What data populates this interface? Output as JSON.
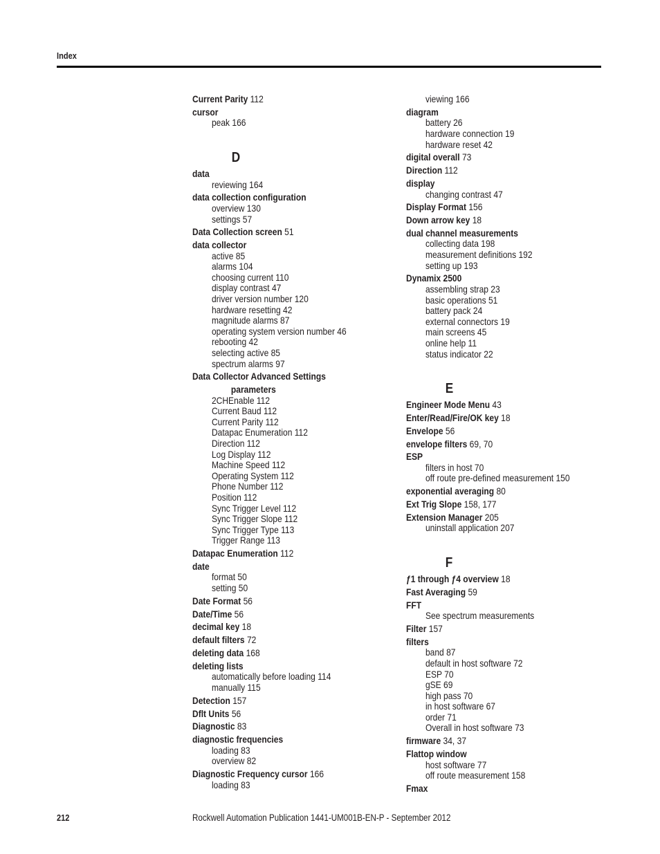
{
  "header": {
    "title": "Index"
  },
  "footer": {
    "page_number": "212",
    "publication": "Rockwell Automation Publication 1441-UM001B-EN-P - September 2012"
  },
  "columns": [
    [
      {
        "type": "main",
        "term": "Current Parity",
        "pages": "112"
      },
      {
        "type": "main",
        "term": "cursor",
        "pages": ""
      },
      {
        "type": "sub",
        "text": "peak 166"
      },
      {
        "type": "letter",
        "text": "D"
      },
      {
        "type": "main",
        "term": "data",
        "pages": ""
      },
      {
        "type": "sub",
        "text": "reviewing 164"
      },
      {
        "type": "main",
        "term": "data collection configuration",
        "pages": ""
      },
      {
        "type": "sub",
        "text": "overview 130"
      },
      {
        "type": "sub",
        "text": "settings 57"
      },
      {
        "type": "main",
        "term": "Data Collection screen",
        "pages": "51"
      },
      {
        "type": "main",
        "term": "data collector",
        "pages": ""
      },
      {
        "type": "sub",
        "text": "active 85"
      },
      {
        "type": "sub",
        "text": "alarms 104"
      },
      {
        "type": "sub",
        "text": "choosing current 110"
      },
      {
        "type": "sub",
        "text": "display contrast 47"
      },
      {
        "type": "sub",
        "text": "driver version number 120"
      },
      {
        "type": "sub",
        "text": "hardware resetting 42"
      },
      {
        "type": "sub",
        "text": "magnitude alarms 87"
      },
      {
        "type": "sub",
        "text": "operating system version number 46"
      },
      {
        "type": "sub",
        "text": "rebooting 42"
      },
      {
        "type": "sub",
        "text": "selecting active 85"
      },
      {
        "type": "sub",
        "text": "spectrum alarms 97"
      },
      {
        "type": "main",
        "term": "Data Collector Advanced Settings",
        "pages": ""
      },
      {
        "type": "subhead",
        "text": "parameters"
      },
      {
        "type": "sub",
        "text": "2CHEnable 112"
      },
      {
        "type": "sub",
        "text": "Current Baud 112"
      },
      {
        "type": "sub",
        "text": "Current Parity 112"
      },
      {
        "type": "sub",
        "text": "Datapac Enumeration 112"
      },
      {
        "type": "sub",
        "text": "Direction 112"
      },
      {
        "type": "sub",
        "text": "Log Display 112"
      },
      {
        "type": "sub",
        "text": "Machine Speed 112"
      },
      {
        "type": "sub",
        "text": "Operating System 112"
      },
      {
        "type": "sub",
        "text": "Phone Number 112"
      },
      {
        "type": "sub",
        "text": "Position 112"
      },
      {
        "type": "sub",
        "text": "Sync Trigger Level 112"
      },
      {
        "type": "sub",
        "text": "Sync Trigger Slope 112"
      },
      {
        "type": "sub",
        "text": "Sync Trigger Type 113"
      },
      {
        "type": "sub",
        "text": "Trigger Range 113"
      },
      {
        "type": "main",
        "term": "Datapac Enumeration",
        "pages": "112"
      },
      {
        "type": "main",
        "term": "date",
        "pages": ""
      },
      {
        "type": "sub",
        "text": "format 50"
      },
      {
        "type": "sub",
        "text": "setting 50"
      },
      {
        "type": "main",
        "term": "Date Format",
        "pages": "56"
      },
      {
        "type": "main",
        "term": "Date/Time",
        "pages": "56"
      },
      {
        "type": "main",
        "term": "decimal key",
        "pages": "18"
      },
      {
        "type": "main",
        "term": "default filters",
        "pages": "72"
      },
      {
        "type": "main",
        "term": "deleting data",
        "pages": "168"
      },
      {
        "type": "main",
        "term": "deleting lists",
        "pages": ""
      },
      {
        "type": "sub",
        "text": "automatically before loading 114"
      },
      {
        "type": "sub",
        "text": "manually 115"
      },
      {
        "type": "main",
        "term": "Detection",
        "pages": "157"
      },
      {
        "type": "main",
        "term": "Dflt Units",
        "pages": "56"
      },
      {
        "type": "main",
        "term": "Diagnostic",
        "pages": "83"
      },
      {
        "type": "main",
        "term": "diagnostic frequencies",
        "pages": ""
      },
      {
        "type": "sub",
        "text": "loading 83"
      },
      {
        "type": "sub",
        "text": "overview 82"
      },
      {
        "type": "main",
        "term": "Diagnostic Frequency cursor",
        "pages": "166"
      },
      {
        "type": "sub",
        "text": "loading 83"
      }
    ],
    [
      {
        "type": "sub",
        "text": "viewing 166"
      },
      {
        "type": "main",
        "term": "diagram",
        "pages": ""
      },
      {
        "type": "sub",
        "text": "battery 26"
      },
      {
        "type": "sub",
        "text": "hardware connection 19"
      },
      {
        "type": "sub",
        "text": "hardware reset 42"
      },
      {
        "type": "main",
        "term": "digital overall",
        "pages": "73"
      },
      {
        "type": "main",
        "term": "Direction",
        "pages": "112"
      },
      {
        "type": "main",
        "term": "display",
        "pages": ""
      },
      {
        "type": "sub",
        "text": "changing contrast 47"
      },
      {
        "type": "main",
        "term": "Display Format",
        "pages": "156"
      },
      {
        "type": "main",
        "term": "Down arrow key",
        "pages": "18"
      },
      {
        "type": "main",
        "term": "dual channel measurements",
        "pages": ""
      },
      {
        "type": "sub",
        "text": "collecting data 198"
      },
      {
        "type": "sub",
        "text": "measurement definitions 192"
      },
      {
        "type": "sub",
        "text": "setting up 193"
      },
      {
        "type": "main",
        "term": "Dynamix 2500",
        "pages": ""
      },
      {
        "type": "sub",
        "text": "assembling strap 23"
      },
      {
        "type": "sub",
        "text": "basic operations 51"
      },
      {
        "type": "sub",
        "text": "battery pack 24"
      },
      {
        "type": "sub",
        "text": "external connectors 19"
      },
      {
        "type": "sub",
        "text": "main screens 45"
      },
      {
        "type": "sub",
        "text": "online help 11"
      },
      {
        "type": "sub",
        "text": "status indicator 22"
      },
      {
        "type": "letter",
        "text": "E"
      },
      {
        "type": "main",
        "term": "Engineer Mode Menu",
        "pages": "43"
      },
      {
        "type": "main",
        "term": "Enter/Read/Fire/OK key",
        "pages": "18"
      },
      {
        "type": "main",
        "term": "Envelope",
        "pages": "56"
      },
      {
        "type": "main",
        "term": "envelope filters",
        "pages": "69, 70"
      },
      {
        "type": "main",
        "term": "ESP",
        "pages": ""
      },
      {
        "type": "sub",
        "text": "filters in host 70"
      },
      {
        "type": "sub",
        "text": "off route pre-defined measurement 150"
      },
      {
        "type": "main",
        "term": "exponential averaging",
        "pages": "80"
      },
      {
        "type": "main",
        "term": "Ext Trig Slope",
        "pages": "158, 177"
      },
      {
        "type": "main",
        "term": "Extension Manager",
        "pages": "205"
      },
      {
        "type": "sub",
        "text": "uninstall application 207"
      },
      {
        "type": "letter",
        "text": "F"
      },
      {
        "type": "main",
        "term": "ƒ1 through ƒ4 overview",
        "pages": "18"
      },
      {
        "type": "main",
        "term": "Fast Averaging",
        "pages": "59"
      },
      {
        "type": "main",
        "term": "FFT",
        "pages": ""
      },
      {
        "type": "sub",
        "text": "See spectrum measurements"
      },
      {
        "type": "main",
        "term": "Filter",
        "pages": "157"
      },
      {
        "type": "main",
        "term": "filters",
        "pages": ""
      },
      {
        "type": "sub",
        "text": "band 87"
      },
      {
        "type": "sub",
        "text": "default in host software 72"
      },
      {
        "type": "sub",
        "text": "ESP 70"
      },
      {
        "type": "sub",
        "text": "gSE 69"
      },
      {
        "type": "sub",
        "text": "high pass 70"
      },
      {
        "type": "sub",
        "text": "in host software 67"
      },
      {
        "type": "sub",
        "text": "order 71"
      },
      {
        "type": "sub",
        "text": "Overall in host software 73"
      },
      {
        "type": "main",
        "term": "firmware",
        "pages": "34, 37"
      },
      {
        "type": "main",
        "term": "Flattop window",
        "pages": ""
      },
      {
        "type": "sub",
        "text": "host software 77"
      },
      {
        "type": "sub",
        "text": "off route measurement 158"
      },
      {
        "type": "main",
        "term": "Fmax",
        "pages": ""
      }
    ]
  ]
}
